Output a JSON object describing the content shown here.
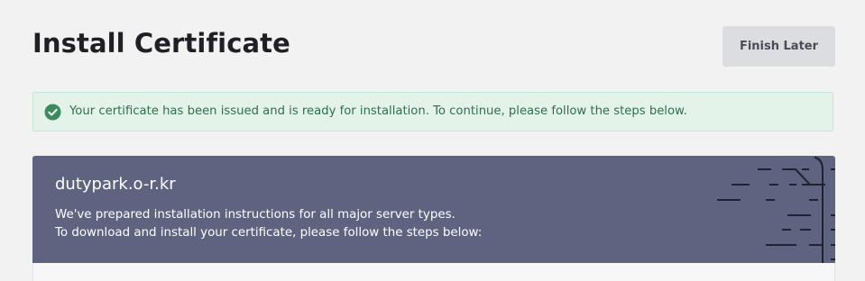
{
  "page": {
    "title": "Install Certificate",
    "finish_later_label": "Finish Later"
  },
  "alert": {
    "icon": "check-circle-icon",
    "message": "Your certificate has been issued and is ready for installation. To continue, please follow the steps below.",
    "color": "#2f6e4c",
    "background": "#e3f3ea"
  },
  "domain_card": {
    "domain": "dutypark.o-r.kr",
    "description_line1": "We've prepared installation instructions for all major server types.",
    "description_line2": "To download and install your certificate, please follow the steps below:",
    "background": "#5e6480",
    "decoration": "circuit-lines-graphic"
  }
}
